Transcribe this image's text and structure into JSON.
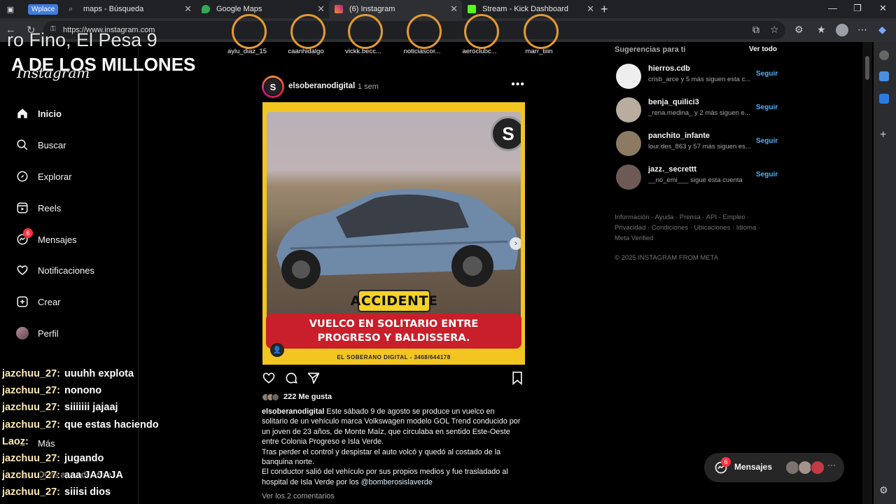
{
  "browser": {
    "wplace_label": "Wplace",
    "tabs": [
      {
        "title": "maps - Búsqueda"
      },
      {
        "title": "Google Maps"
      },
      {
        "title": "(6) Instagram"
      },
      {
        "title": "Stream - Kick Dashboard"
      }
    ],
    "url": "https://www.instagram.com"
  },
  "overlay": {
    "line1": "ro Fino, El Pesa 9",
    "line2": "A DE LOS MILLONES"
  },
  "chat": [
    {
      "user": "jazchuu_27:",
      "msg": "uuuhh explota"
    },
    {
      "user": "jazchuu_27:",
      "msg": "nonono"
    },
    {
      "user": "jazchuu_27:",
      "msg": "siiiiiii jajaaj"
    },
    {
      "user": "jazchuu_27:",
      "msg": "que estas haciendo"
    },
    {
      "user": "Laoz:",
      "msg": ""
    },
    {
      "user": "jazchuu_27:",
      "msg": "jugando"
    },
    {
      "user": "jazchuu_27:",
      "msg": "aaa JAJAJA"
    },
    {
      "user": "jazchuu_27:",
      "msg": "siiisi dios"
    }
  ],
  "nav": {
    "logo": "Instagram",
    "items": [
      {
        "label": "Inicio"
      },
      {
        "label": "Buscar"
      },
      {
        "label": "Explorar"
      },
      {
        "label": "Reels"
      },
      {
        "label": "Mensajes",
        "badge": "6"
      },
      {
        "label": "Notificaciones"
      },
      {
        "label": "Crear"
      },
      {
        "label": "Perfil"
      }
    ],
    "more": "Más",
    "other_apps": "Otras apps de Meta"
  },
  "stories": [
    "aylu_diaz_15",
    "caanhidalgo",
    "vickk.becc...",
    "noticiascor...",
    "aeroclubc...",
    "marr_tiiin"
  ],
  "post": {
    "user": "elsoberanodigital",
    "time": "1 sem",
    "image": {
      "logo": "S",
      "tag": "ACCIDENTE",
      "headline_1": "VUELCO EN SOLITARIO ENTRE",
      "headline_2": "PROGRESO Y BALDISSERA.",
      "footer": "EL SOBERANO DIGITAL - 3468/644178"
    },
    "likes": "222 Me gusta",
    "caption_user": "elsoberanodigital",
    "caption_1": "Este sábado 9 de agosto se produce un vuelco en solitario de un vehículo marca Volkswagen modelo GOL Trend conducido por un joven de 23 años, de Monte Maíz, que circulaba en sentido Este-Oeste entre Colonia Progreso e Isla Verde.",
    "caption_2": "Tras perder el control y despistar el auto volcó y quedó al costado de la banquina norte.",
    "caption_3": "El conductor salió del vehículo por sus propios medios y fue trasladado al hospital de Isla Verde por los",
    "mention": "@bomberosislaverde",
    "comments": "Ver los 2 comentarios"
  },
  "suggestions": {
    "heading": "Sugerencias para ti",
    "see_all": "Ver todo",
    "follow": "Seguir",
    "items": [
      {
        "user": "hierros.cdb",
        "sub": "crisb_arce y 5 más siguen esta c..."
      },
      {
        "user": "benja_quilici3",
        "sub": "_rena.medina_ y 2 más siguen e..."
      },
      {
        "user": "panchito_infante",
        "sub": "lour.des_863 y 57 más siguen es..."
      },
      {
        "user": "jazz._secrettt",
        "sub": "__no_emi___ sigue esta cuenta"
      }
    ],
    "footer_links": "Información · Ayuda · Prensa · API · Empleo · Privacidad · Condiciones · Ubicaciones · Idioma · Meta Verified",
    "copyright": "© 2025 INSTAGRAM FROM META"
  },
  "messages_pill": {
    "label": "Mensajes",
    "badge": "6"
  },
  "colors": {
    "accent_blue": "#4cb5f9",
    "badge_red": "#ff3040",
    "post_yellow": "#f2c520",
    "post_red": "#c81f2a"
  }
}
